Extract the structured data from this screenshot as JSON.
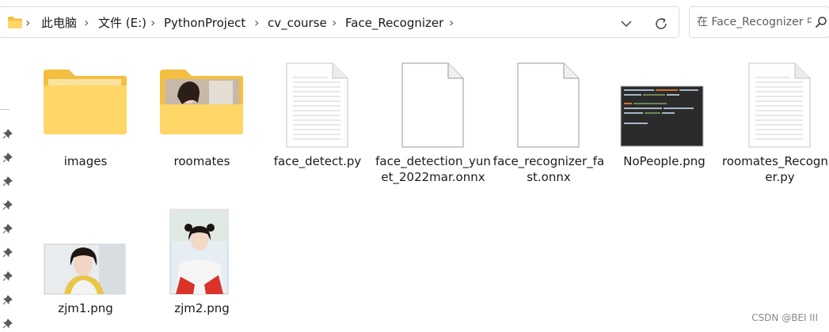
{
  "breadcrumb": {
    "items": [
      "此电脑",
      "文件 (E:)",
      "PythonProject",
      "cv_course",
      "Face_Recognizer"
    ],
    "separator": ">"
  },
  "search": {
    "placeholder": "在 Face_Recognizer 中搜索"
  },
  "files": [
    {
      "name": "images",
      "kind": "folder"
    },
    {
      "name": "roomates",
      "kind": "folder-photo"
    },
    {
      "name": "face_detect.py",
      "kind": "py"
    },
    {
      "name": "face_detection_yunet_2022mar.onnx",
      "kind": "blank"
    },
    {
      "name": "face_recognizer_fast.onnx",
      "kind": "blank"
    },
    {
      "name": "NoPeople.png",
      "kind": "code-image"
    },
    {
      "name": "roomates_Recognizer.py",
      "kind": "py"
    },
    {
      "name": "zjm1.png",
      "kind": "photo"
    },
    {
      "name": "zjm2.png",
      "kind": "photo"
    }
  ],
  "watermark": "CSDN @BEI III",
  "colors": {
    "folder_back": "#f4bf40",
    "folder_front": "#ffd667",
    "folder_tab_light": "#fbe3a0",
    "accent_text": "#1a1a1a"
  },
  "icons": {
    "address_folder": "folder-icon",
    "dropdown": "chevron-down-icon",
    "refresh": "refresh-icon",
    "search": "search-icon",
    "pin": "pin-icon"
  }
}
